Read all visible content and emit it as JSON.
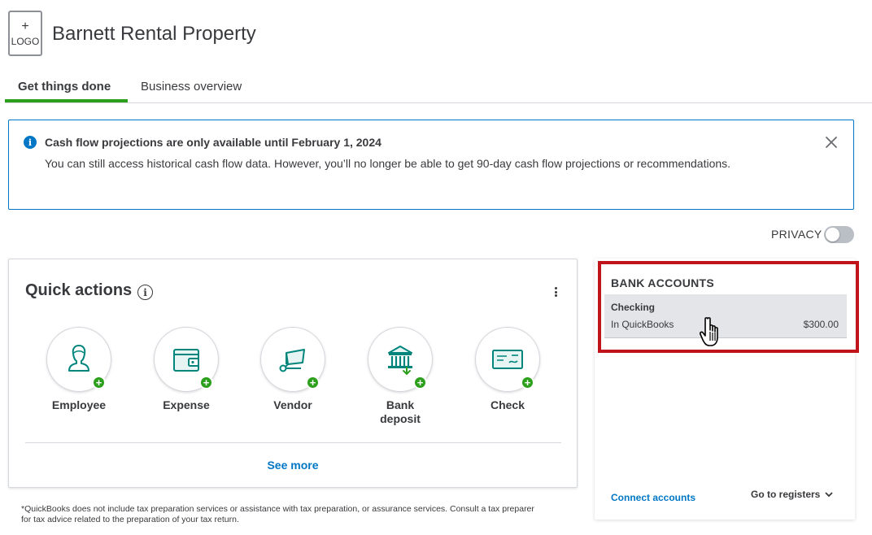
{
  "header": {
    "logo_plus": "+",
    "logo_text": "LOGO",
    "company_name": "Barnett Rental Property"
  },
  "tabs": [
    {
      "label": "Get things done",
      "active": true
    },
    {
      "label": "Business overview",
      "active": false
    }
  ],
  "banner": {
    "title": "Cash flow projections are only available until February 1, 2024",
    "text": "You can still access historical cash flow data. However, you’ll no longer be able to get 90-day cash flow projections or recommendations."
  },
  "privacy": {
    "label": "PRIVACY",
    "enabled": false
  },
  "quick_actions": {
    "title": "Quick actions",
    "items": [
      {
        "label": "Employee",
        "icon": "employee-icon"
      },
      {
        "label": "Expense",
        "icon": "expense-wallet-icon"
      },
      {
        "label": "Vendor",
        "icon": "vendor-cart-icon"
      },
      {
        "label": "Bank\ndeposit",
        "icon": "bank-deposit-icon"
      },
      {
        "label": "Check",
        "icon": "check-icon"
      }
    ],
    "see_more": "See more"
  },
  "disclaimer": "*QuickBooks does not include tax preparation services or assistance with tax preparation, or assurance services. Consult a tax preparer for tax advice related to the preparation of your tax return.",
  "bank_accounts": {
    "title": "BANK ACCOUNTS",
    "accounts": [
      {
        "name": "Checking",
        "source": "In QuickBooks",
        "amount": "$300.00"
      }
    ],
    "connect_label": "Connect accounts",
    "registers_label": "Go to registers"
  },
  "colors": {
    "accent_green": "#2ca01c",
    "link_blue": "#0077c5",
    "highlight_red": "#c0141a",
    "icon_teal": "#00857c"
  }
}
